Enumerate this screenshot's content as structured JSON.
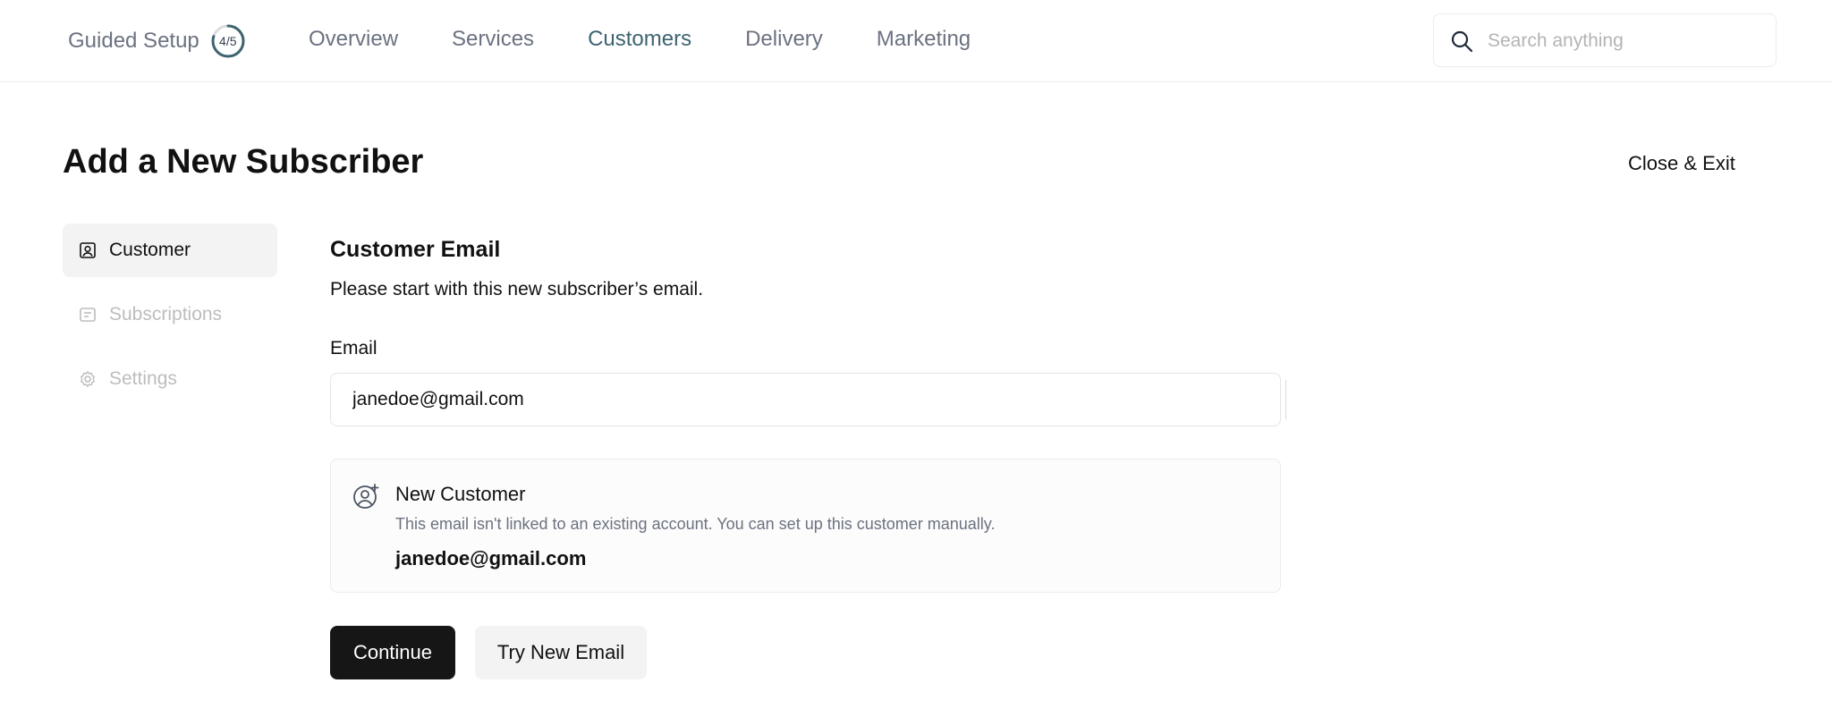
{
  "topbar": {
    "guided_setup_label": "Guided Setup",
    "progress_text": "4/5",
    "progress_fraction": 0.8,
    "nav_items": [
      {
        "label": "Overview"
      },
      {
        "label": "Services"
      },
      {
        "label": "Customers",
        "active": true
      },
      {
        "label": "Delivery"
      },
      {
        "label": "Marketing"
      }
    ],
    "search_placeholder": "Search anything",
    "search_value": ""
  },
  "page": {
    "title": "Add a New Subscriber",
    "close_label": "Close & Exit"
  },
  "steps": [
    {
      "label": "Customer",
      "icon": "user-square-icon",
      "active": true
    },
    {
      "label": "Subscriptions",
      "icon": "list-card-icon",
      "active": false
    },
    {
      "label": "Settings",
      "icon": "gear-icon",
      "active": false
    }
  ],
  "form": {
    "section_title": "Customer Email",
    "section_desc": "Please start with this new subscriber’s email.",
    "email_label": "Email",
    "email_value": "janedoe@gmail.com"
  },
  "card": {
    "icon": "user-plus-icon",
    "title": "New Customer",
    "text": "This email isn't linked to an existing account. You can set up this customer manually.",
    "email": "janedoe@gmail.com"
  },
  "buttons": {
    "continue_label": "Continue",
    "try_new_label": "Try New Email"
  },
  "colors": {
    "accent": "#3d6470",
    "primary_button": "#161616",
    "muted_text": "#6b7280"
  }
}
